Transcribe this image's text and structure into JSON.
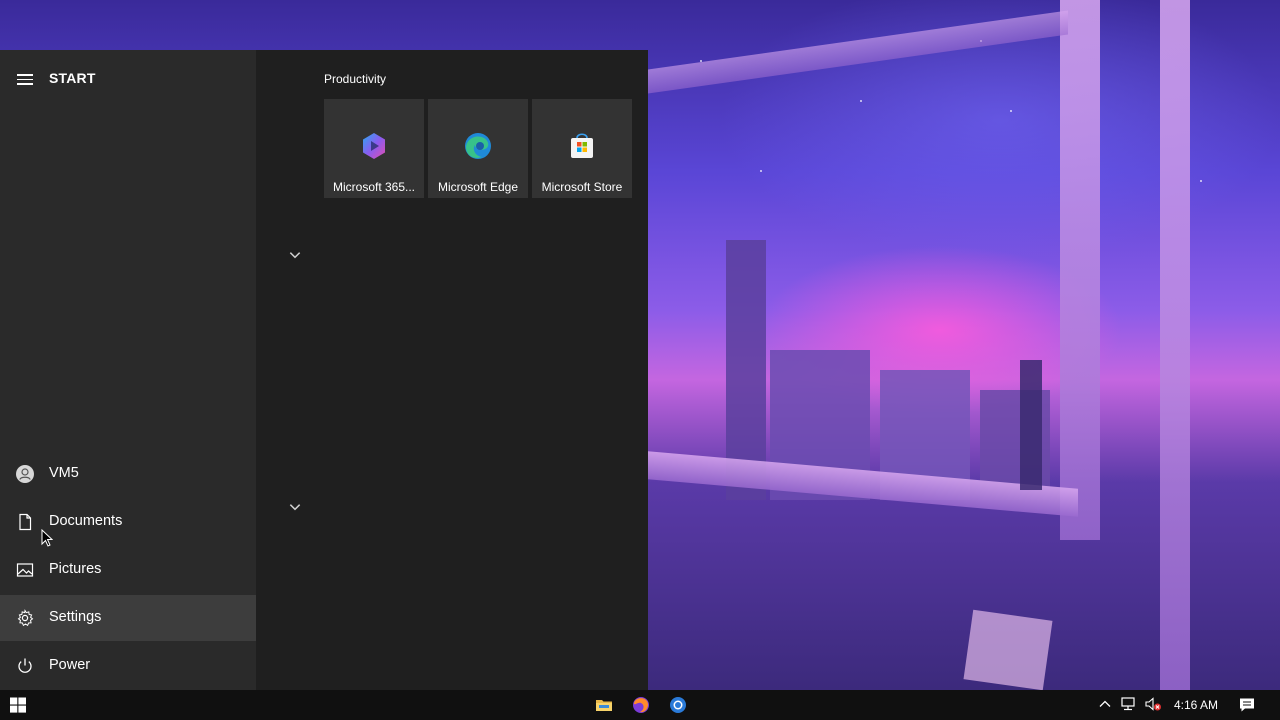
{
  "start_menu": {
    "title": "START",
    "rail_items": [
      {
        "label": "VM5",
        "icon": "user-avatar-icon"
      },
      {
        "label": "Documents",
        "icon": "document-icon"
      },
      {
        "label": "Pictures",
        "icon": "pictures-icon"
      },
      {
        "label": "Settings",
        "icon": "gear-icon"
      },
      {
        "label": "Power",
        "icon": "power-icon"
      }
    ],
    "groups": [
      {
        "title": "Productivity",
        "tiles": [
          {
            "label": "Microsoft 365...",
            "icon": "microsoft-365-icon"
          },
          {
            "label": "Microsoft Edge",
            "icon": "edge-icon"
          },
          {
            "label": "Microsoft Store",
            "icon": "store-icon"
          }
        ]
      }
    ]
  },
  "taskbar": {
    "apps": [
      {
        "icon": "file-explorer-icon"
      },
      {
        "icon": "firefox-icon"
      },
      {
        "icon": "browser-icon"
      }
    ],
    "tray": {
      "clock": "4:16 AM"
    }
  },
  "colors": {
    "start_bg": "#1f1f1f",
    "rail_bg": "#2a2a2a",
    "tile_bg": "#333333",
    "taskbar_bg": "#101010"
  }
}
